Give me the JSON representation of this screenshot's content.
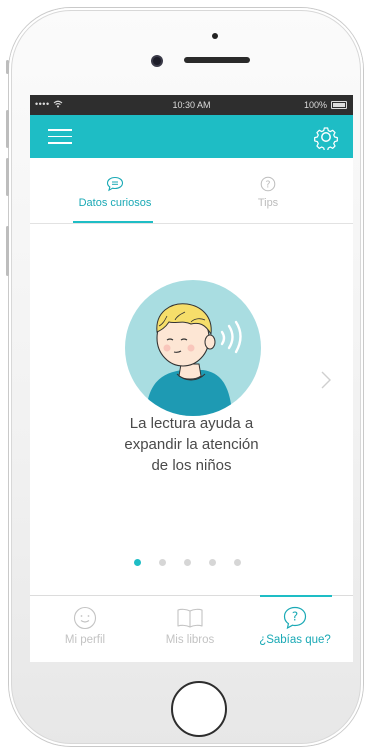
{
  "status_bar": {
    "signal": "•••• ",
    "time": "10:30 AM",
    "battery": "100%"
  },
  "tabs": [
    {
      "label": "Datos curiosos",
      "icon": "chat-bubble-icon",
      "active": true
    },
    {
      "label": "Tips",
      "icon": "question-circle-icon",
      "active": false
    }
  ],
  "fact": {
    "line1": "La lectura ayuda a",
    "line2": "expandir la atención",
    "line3": "de los niños"
  },
  "pager": {
    "count": 5,
    "active_index": 0
  },
  "bottom_nav": [
    {
      "label": "Mi perfil",
      "icon": "smiley-icon",
      "active": false
    },
    {
      "label": "Mis libros",
      "icon": "book-icon",
      "active": false
    },
    {
      "label": "¿Sabías que?",
      "icon": "question-bubble-icon",
      "active": true
    }
  ],
  "colors": {
    "accent": "#1ebdc5",
    "status_bar": "#2e2e2e",
    "illustration_bg": "#a9dde1",
    "inactive": "#c3c3c3"
  }
}
